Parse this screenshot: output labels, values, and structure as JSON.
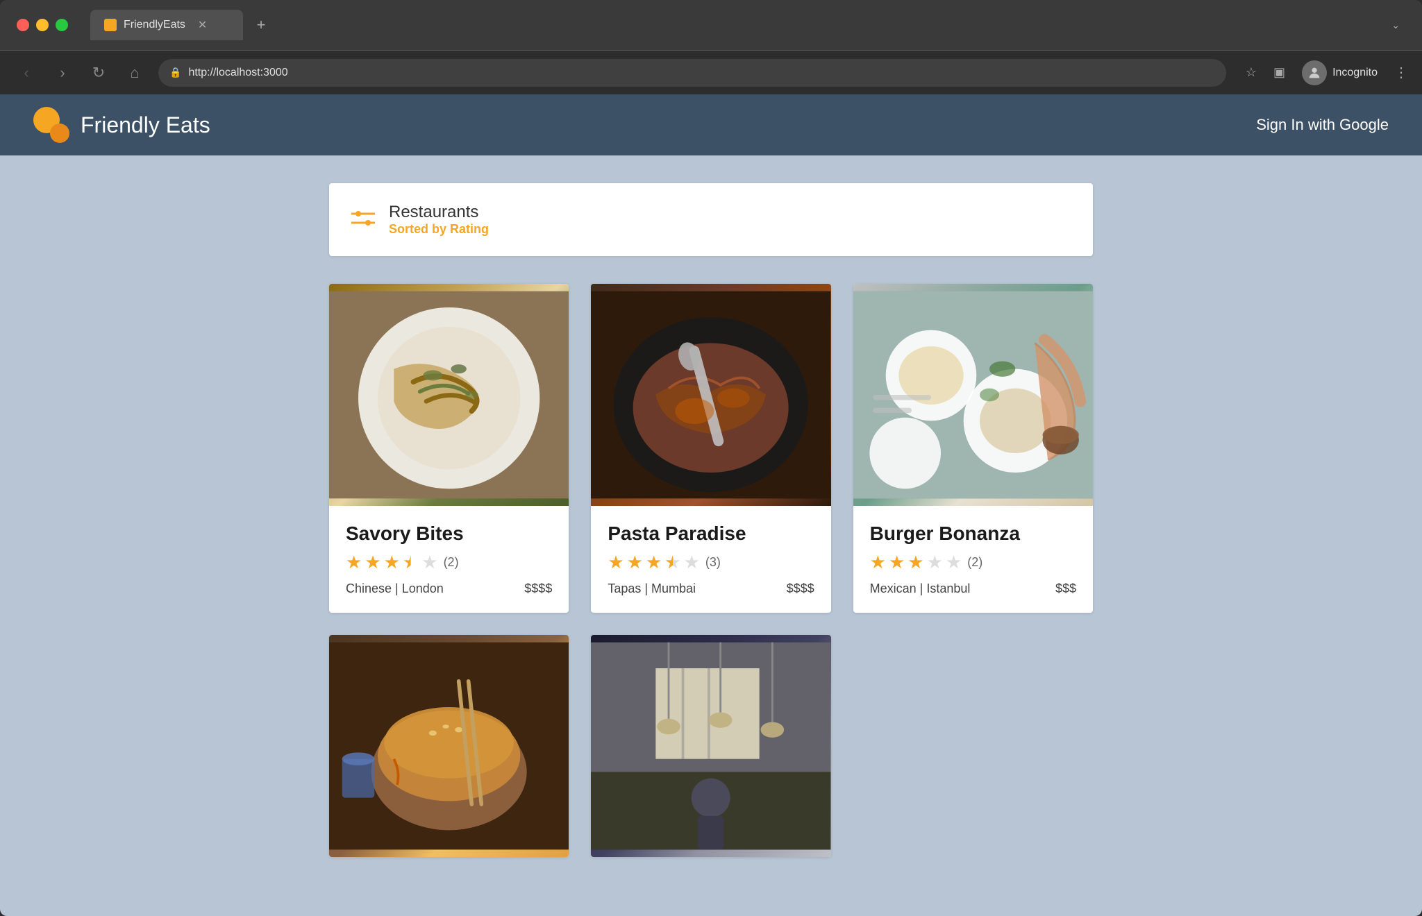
{
  "browser": {
    "tab_title": "FriendlyEats",
    "url": "http://localhost:3000",
    "incognito_label": "Incognito",
    "new_tab_label": "+",
    "more_label": "⌄"
  },
  "nav": {
    "back_label": "‹",
    "forward_label": "›",
    "reload_label": "↻",
    "home_label": "⌂"
  },
  "app": {
    "title": "Friendly Eats",
    "sign_in_label": "Sign In with Google"
  },
  "filter": {
    "title": "Restaurants",
    "subtitle": "Sorted by Rating"
  },
  "restaurants": [
    {
      "id": 1,
      "name": "Savory Bites",
      "cuisine": "Chinese",
      "city": "London",
      "price": "$$$$",
      "rating": 3.5,
      "review_count": 2,
      "stars_filled": 3,
      "stars_half": true,
      "stars_empty": 1,
      "img_class": "img-savory"
    },
    {
      "id": 2,
      "name": "Pasta Paradise",
      "cuisine": "Tapas",
      "city": "Mumbai",
      "price": "$$$$",
      "rating": 3.5,
      "review_count": 3,
      "stars_filled": 3,
      "stars_half": true,
      "stars_empty": 1,
      "img_class": "img-pasta"
    },
    {
      "id": 3,
      "name": "Burger Bonanza",
      "cuisine": "Mexican",
      "city": "Istanbul",
      "price": "$$$",
      "rating": 3,
      "review_count": 2,
      "stars_filled": 3,
      "stars_half": false,
      "stars_empty": 2,
      "img_class": "img-burger"
    }
  ],
  "bottom_restaurants": [
    {
      "id": 4,
      "img_class": "img-bottom1"
    },
    {
      "id": 5,
      "img_class": "img-bottom2"
    }
  ]
}
